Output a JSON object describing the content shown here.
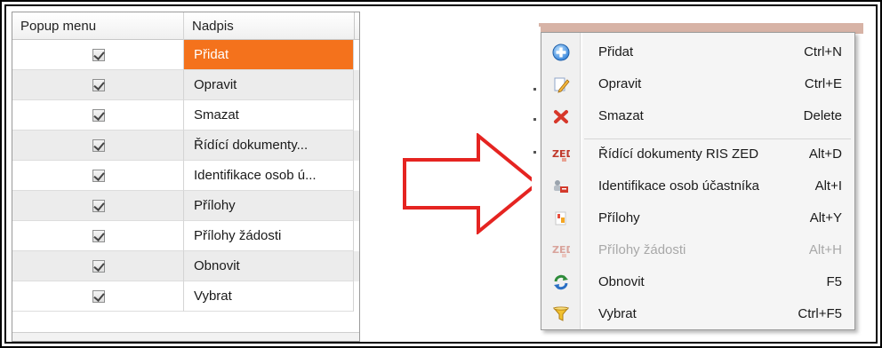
{
  "grid": {
    "columns": {
      "popup": "Popup menu",
      "label": "Nadpis"
    },
    "rows": [
      {
        "checked": true,
        "label": "Přidat",
        "selected": true
      },
      {
        "checked": true,
        "label": "Opravit",
        "selected": false
      },
      {
        "checked": true,
        "label": "Smazat",
        "selected": false
      },
      {
        "checked": true,
        "label": "Řídící dokumenty...",
        "selected": false
      },
      {
        "checked": true,
        "label": "Identifikace osob ú...",
        "selected": false
      },
      {
        "checked": true,
        "label": "Přílohy",
        "selected": false
      },
      {
        "checked": true,
        "label": "Přílohy žádosti",
        "selected": false
      },
      {
        "checked": true,
        "label": "Obnovit",
        "selected": false
      },
      {
        "checked": true,
        "label": "Vybrat",
        "selected": false
      }
    ],
    "selected_color": "#f4721c"
  },
  "menu": {
    "items": [
      {
        "icon": "plus-circle-icon",
        "label": "Přidat",
        "shortcut": "Ctrl+N",
        "disabled": false
      },
      {
        "icon": "pencil-icon",
        "label": "Opravit",
        "shortcut": "Ctrl+E",
        "disabled": false
      },
      {
        "icon": "delete-x-icon",
        "label": "Smazat",
        "shortcut": "Delete",
        "disabled": false
      },
      {
        "icon": "zed-icon",
        "label": "Řídící dokumenty RIS ZED",
        "shortcut": "Alt+D",
        "disabled": false
      },
      {
        "icon": "persons-id-icon",
        "label": "Identifikace osob účastníka",
        "shortcut": "Alt+I",
        "disabled": false
      },
      {
        "icon": "attachment-icon",
        "label": "Přílohy",
        "shortcut": "Alt+Y",
        "disabled": false
      },
      {
        "icon": "zed-icon",
        "label": "Přílohy žádosti",
        "shortcut": "Alt+H",
        "disabled": true
      },
      {
        "icon": "refresh-icon",
        "label": "Obnovit",
        "shortcut": "F5",
        "disabled": false
      },
      {
        "icon": "filter-funnel-icon",
        "label": "Vybrat",
        "shortcut": "Ctrl+F5",
        "disabled": false
      }
    ]
  },
  "arrow": {
    "color": "#e52421",
    "direction": "right"
  }
}
